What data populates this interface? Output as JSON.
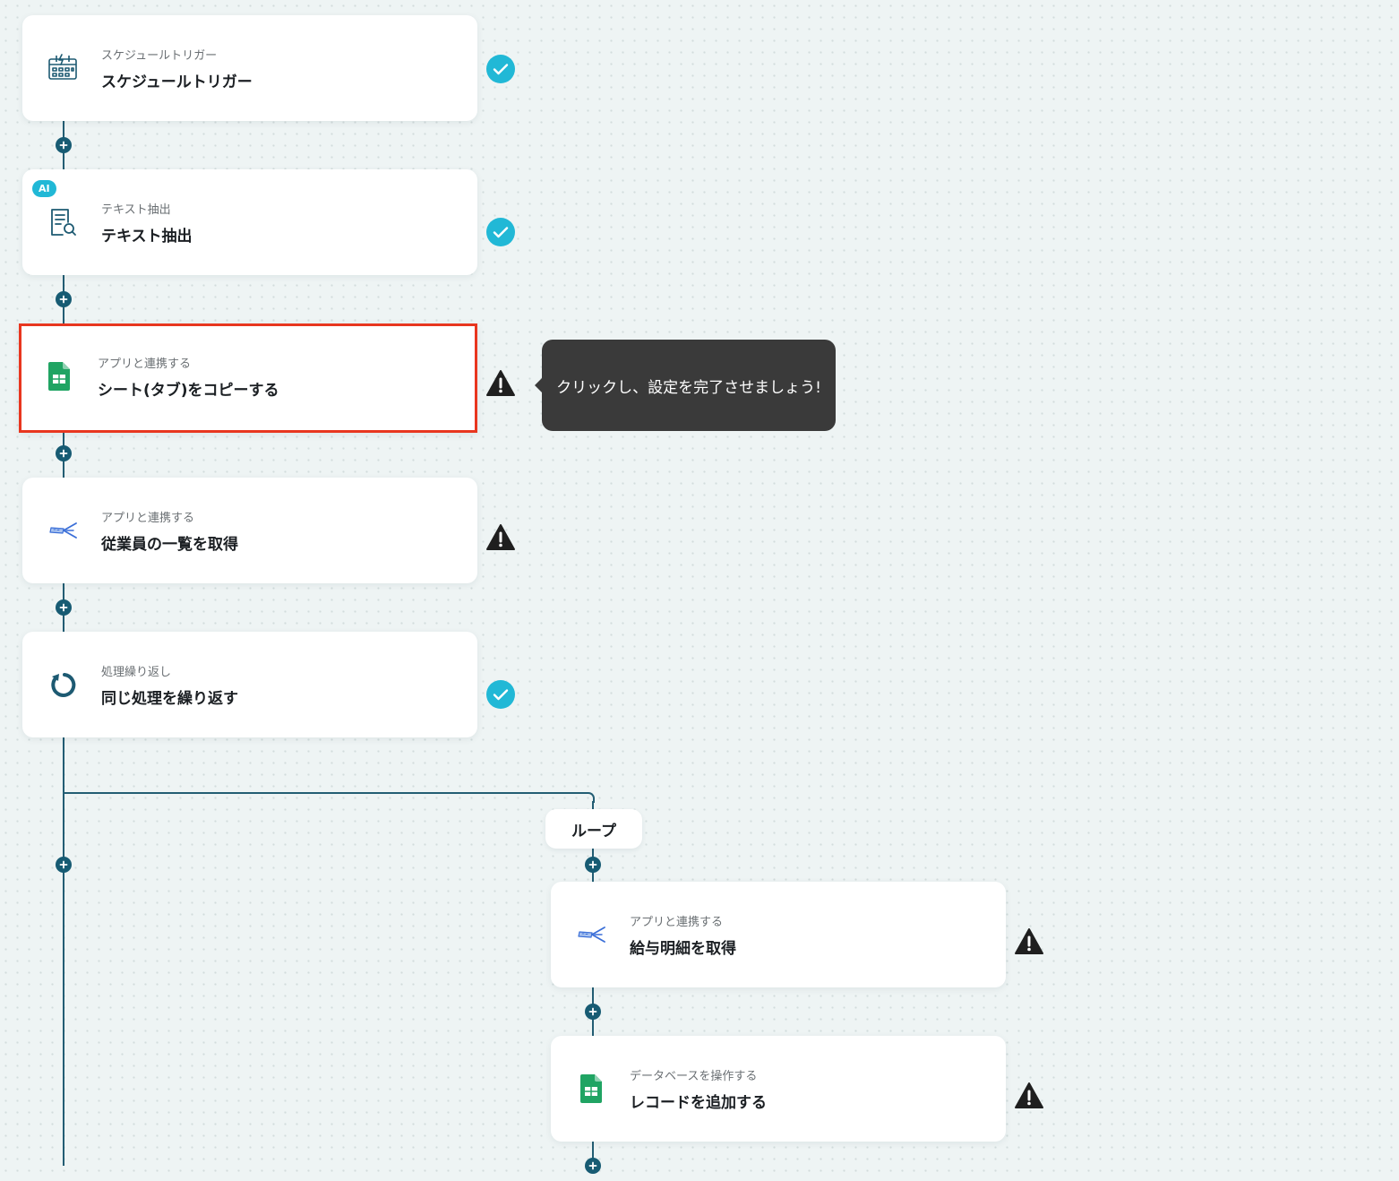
{
  "steps": [
    {
      "subtitle": "スケジュールトリガー",
      "title": "スケジュールトリガー",
      "icon": "calendar-bolt-icon",
      "status": "done"
    },
    {
      "subtitle": "テキスト抽出",
      "title": "テキスト抽出",
      "icon": "document-search-icon",
      "badge": "AI",
      "status": "done"
    },
    {
      "subtitle": "アプリと連携する",
      "title": "シート(タブ)をコピーする",
      "icon": "google-sheets-icon",
      "status": "warning",
      "selected": true
    },
    {
      "subtitle": "アプリと連携する",
      "title": "従業員の一覧を取得",
      "icon": "payroll-app-icon",
      "status": "warning"
    },
    {
      "subtitle": "処理繰り返し",
      "title": "同じ処理を繰り返す",
      "icon": "loop-arrow-icon",
      "status": "done"
    },
    {
      "subtitle": "アプリと連携する",
      "title": "給与明細を取得",
      "icon": "payroll-app-icon",
      "status": "warning"
    },
    {
      "subtitle": "データベースを操作する",
      "title": "レコードを追加する",
      "icon": "google-sheets-icon",
      "status": "warning"
    }
  ],
  "tooltip": {
    "text": "クリックし、設定を完了させましょう!"
  },
  "loop": {
    "label": "ループ"
  },
  "colors": {
    "accent_check": "#21b8d6",
    "warning": "#1f1f1f",
    "connector": "#235d73",
    "selected_border": "#e8361f",
    "tooltip_bg": "#3a3a3a"
  }
}
